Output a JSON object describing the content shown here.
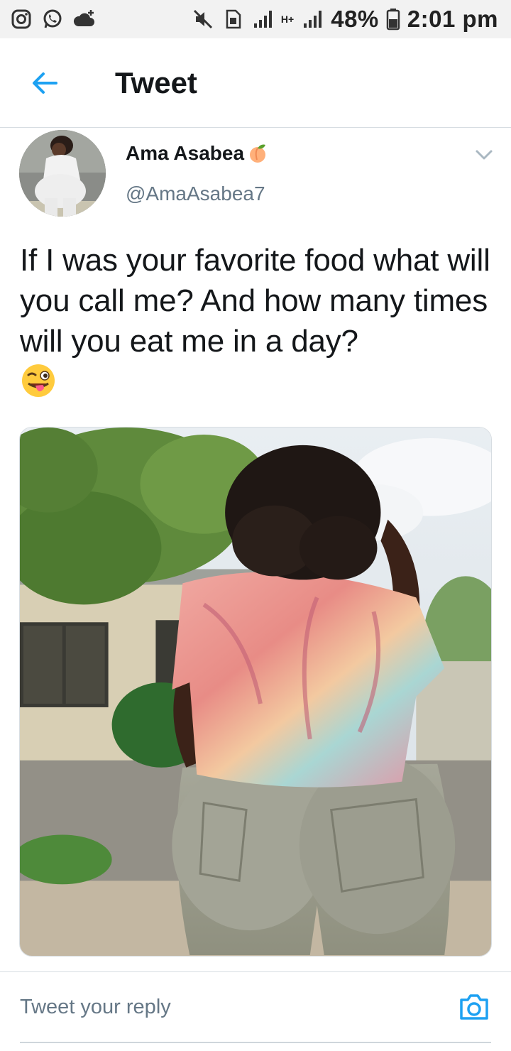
{
  "status_bar": {
    "battery": "48%",
    "time": "2:01 pm",
    "network_label": "H+"
  },
  "app_bar": {
    "title": "Tweet",
    "back_icon": "arrow-left-icon"
  },
  "tweet": {
    "author_name": "Ama Asabea",
    "author_badge_icon": "peach-emoji-icon",
    "author_handle": "@AmaAsabea7",
    "text": "If I was your favorite food what will you call me? And how many times will you eat me in a day?",
    "trailing_emoji_icon": "winking-face-tongue-emoji-icon",
    "media_description_icon": "photo"
  },
  "reply": {
    "placeholder": "Tweet your reply",
    "camera_icon": "camera-icon"
  },
  "colors": {
    "accent": "#1da1f2",
    "text_primary": "#14171a",
    "text_secondary": "#657786",
    "divider": "#d7dde2",
    "status_bar_bg": "#f2f2f2"
  }
}
